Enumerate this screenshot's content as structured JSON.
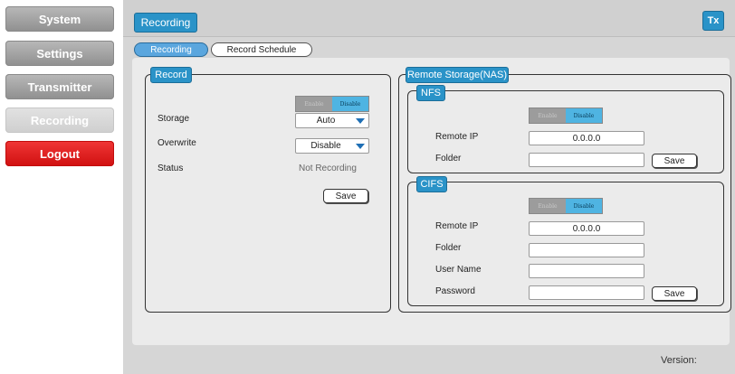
{
  "sidebar": {
    "items": [
      {
        "label": "System"
      },
      {
        "label": "Settings"
      },
      {
        "label": "Transmitter"
      },
      {
        "label": "Recording"
      },
      {
        "label": "Logout"
      }
    ]
  },
  "header": {
    "title": "Recording",
    "tx_badge": "Tx"
  },
  "tabs": [
    {
      "label": "Recording",
      "active": true
    },
    {
      "label": "Record Schedule",
      "active": false
    }
  ],
  "record": {
    "title": "Record",
    "toggle": {
      "enable": "Enable",
      "disable": "Disable",
      "selected": "Disable"
    },
    "storage_label": "Storage",
    "storage_value": "Auto",
    "overwrite_label": "Overwrite",
    "overwrite_value": "Disable",
    "status_label": "Status",
    "status_value": "Not Recording",
    "save_label": "Save"
  },
  "remote": {
    "title": "Remote Storage(NAS)",
    "nfs": {
      "title": "NFS",
      "toggle": {
        "enable": "Enable",
        "disable": "Disable",
        "selected": "Disable"
      },
      "remote_ip_label": "Remote IP",
      "remote_ip_value": "0.0.0.0",
      "folder_label": "Folder",
      "folder_value": "",
      "save_label": "Save"
    },
    "cifs": {
      "title": "CIFS",
      "toggle": {
        "enable": "Enable",
        "disable": "Disable",
        "selected": "Disable"
      },
      "remote_ip_label": "Remote IP",
      "remote_ip_value": "0.0.0.0",
      "folder_label": "Folder",
      "folder_value": "",
      "username_label": "User Name",
      "username_value": "",
      "password_label": "Password",
      "password_value": "",
      "save_label": "Save"
    }
  },
  "footer": {
    "version_label": "Version:"
  }
}
